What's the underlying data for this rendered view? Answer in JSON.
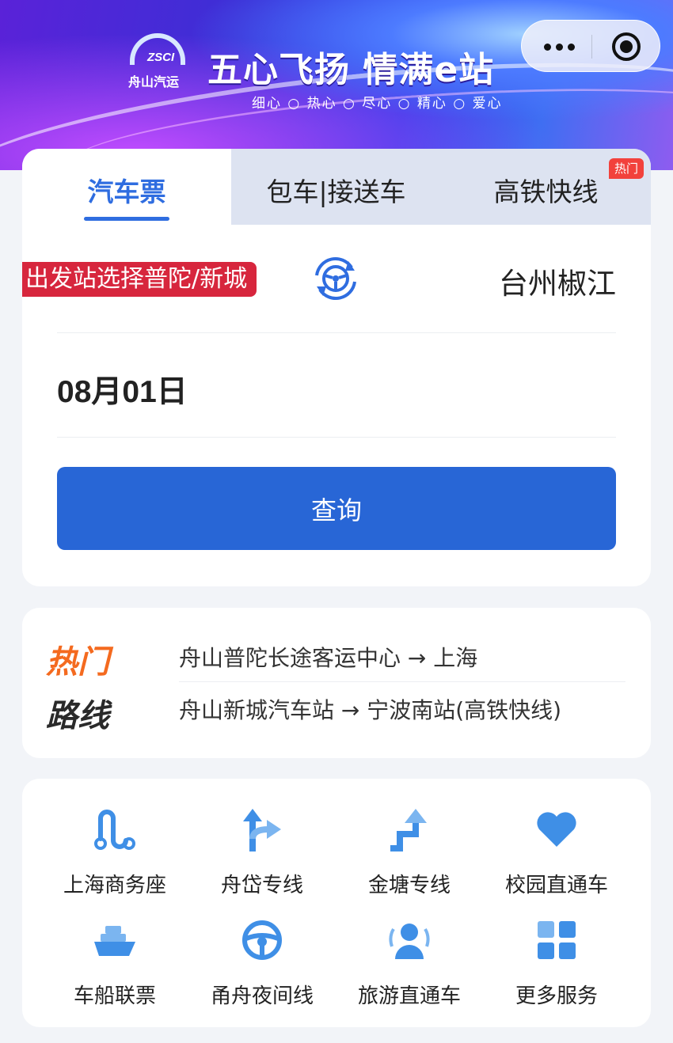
{
  "banner": {
    "logo_text": "ZSCI",
    "logo_sub": "舟山汽运",
    "slogan": "五心飞扬 情满e站",
    "slogan_sub": "细心 ○ 热心 ○ 尽心 ○ 精心 ○ 爱心"
  },
  "capsule": {
    "more_icon": "more-dots-icon",
    "close_icon": "target-close-icon"
  },
  "tabs": [
    {
      "label": "汽车票",
      "active": true
    },
    {
      "label": "包车|接送车",
      "active": false
    },
    {
      "label": "高铁快线",
      "active": false,
      "badge": "热门"
    }
  ],
  "search": {
    "from_badge": "出发站选择普陀/新城",
    "to_station": "台州椒江",
    "date": "08月01日",
    "search_button": "查询"
  },
  "hot_routes": {
    "title_top": "热门",
    "title_bottom": "路线",
    "routes": [
      "舟山普陀长途客运中心 → 上海",
      "舟山新城汽车站 → 宁波南站(高铁快线)"
    ]
  },
  "services": [
    {
      "label": "上海商务座",
      "icon": "route-icon"
    },
    {
      "label": "舟岱专线",
      "icon": "fork-arrow-icon"
    },
    {
      "label": "金塘专线",
      "icon": "stair-arrow-icon"
    },
    {
      "label": "校园直通车",
      "icon": "heart-icon"
    },
    {
      "label": "车船联票",
      "icon": "ship-icon"
    },
    {
      "label": "甬舟夜间线",
      "icon": "steering-wheel-icon"
    },
    {
      "label": "旅游直通车",
      "icon": "users-icon"
    },
    {
      "label": "更多服务",
      "icon": "grid-icon"
    }
  ],
  "colors": {
    "accent": "#2866d6",
    "hot": "#f46a1f",
    "badge_red": "#d7263d"
  }
}
